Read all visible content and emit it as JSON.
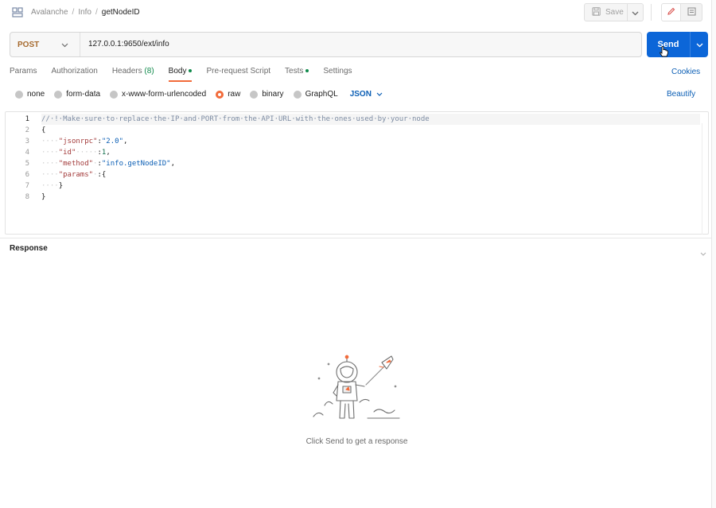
{
  "breadcrumb": {
    "collection": "Avalanche",
    "separator": "/",
    "folder": "Info",
    "request": "getNodeID"
  },
  "toolbar": {
    "save_label": "Save"
  },
  "request": {
    "method": "POST",
    "url": "127.0.0.1:9650/ext/info",
    "send_label": "Send"
  },
  "tabs": [
    {
      "label": "Params"
    },
    {
      "label": "Authorization"
    },
    {
      "label": "Headers",
      "count": "(8)"
    },
    {
      "label": "Body",
      "active": true,
      "dot": true
    },
    {
      "label": "Pre-request Script"
    },
    {
      "label": "Tests",
      "dot": true
    },
    {
      "label": "Settings"
    }
  ],
  "cookies_label": "Cookies",
  "body_types": {
    "none": "none",
    "form_data": "form-data",
    "urlencoded": "x-www-form-urlencoded",
    "raw": "raw",
    "binary": "binary",
    "graphql": "GraphQL",
    "selected": "raw",
    "language": "JSON"
  },
  "beautify_label": "Beautify",
  "editor": {
    "line_numbers": [
      "1",
      "2",
      "3",
      "4",
      "5",
      "6",
      "7",
      "8"
    ],
    "comment": "//·!·Make·sure·to·replace·the·IP·and·PORT·from·the·API·URL·with·the·ones·used·by·your·node",
    "line2": "{",
    "line3_key": "\"jsonrpc\"",
    "line3_val": "\"2.0\"",
    "line4_key": "\"id\"",
    "line4_val": "1",
    "line5_key": "\"method\"",
    "line5_val": "\"info.getNodeID\"",
    "line6_key": "\"params\"",
    "line6_rest": "{",
    "line7": "}",
    "line8": "}"
  },
  "response": {
    "title": "Response",
    "empty_message": "Click Send to get a response"
  },
  "colors": {
    "send_blue": "#0c66d8",
    "post_method": "#a66a2e",
    "active_tab_underline": "#f26b3a",
    "link_blue": "#0c5fb5",
    "status_green": "#0f8a4b"
  }
}
